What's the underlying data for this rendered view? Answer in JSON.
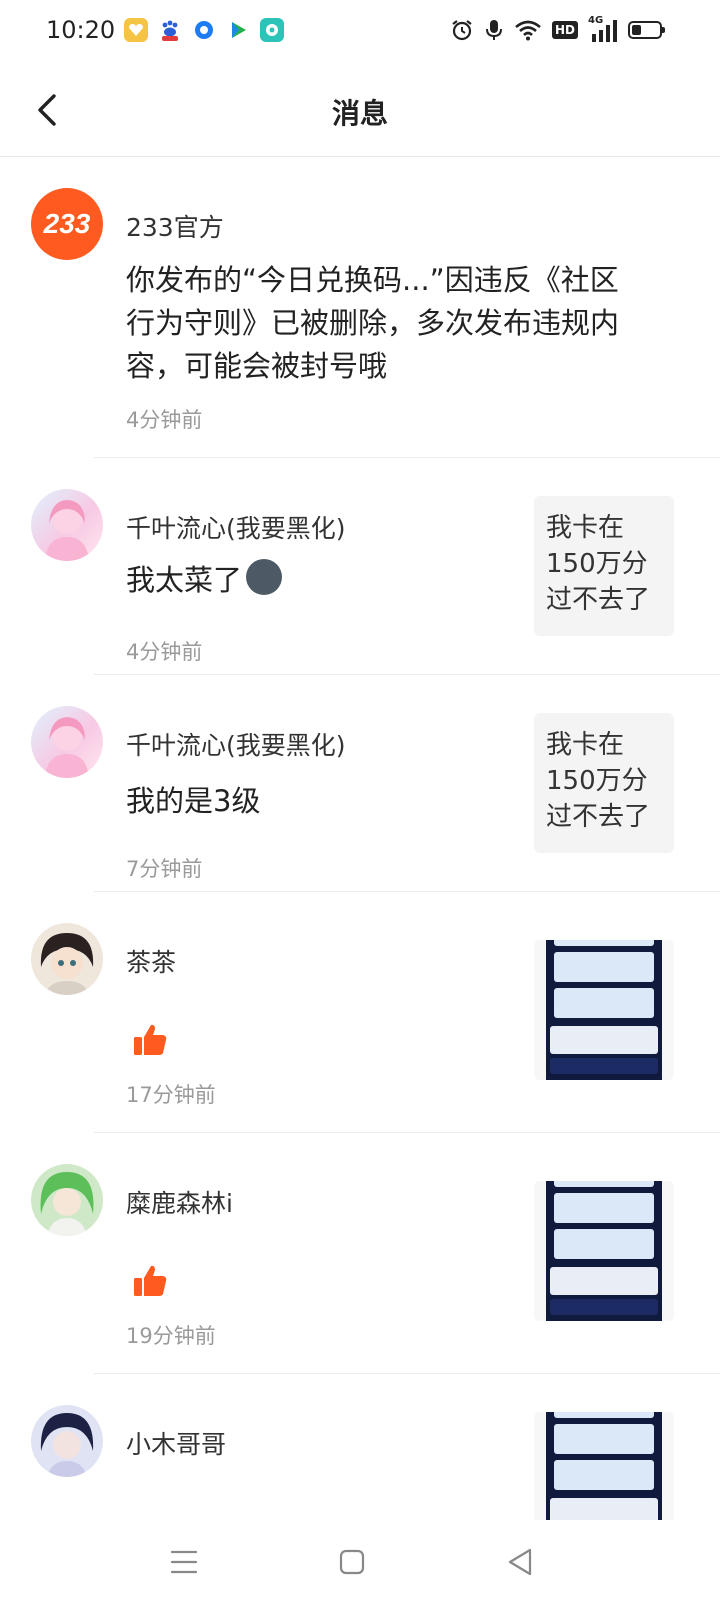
{
  "status_bar": {
    "time": "10:20",
    "network": "4G",
    "hd": "HD"
  },
  "header": {
    "title": "消息"
  },
  "messages": [
    {
      "user": "233官方",
      "avatar_text": "233",
      "avatar_color": "#ff5a1f",
      "text": "你发布的“今日兑换码...”因违反《社区行为守则》已被删除，多次发布违规内容，可能会被封号哦",
      "time": "4分钟前"
    },
    {
      "user": "千叶流心(我要黑化)",
      "text": "我太菜了",
      "emoji": "🌚",
      "time": "4分钟前",
      "quote": "我卡在150万分过不去了"
    },
    {
      "user": "千叶流心(我要黑化)",
      "text": "我的是3级",
      "time": "7分钟前",
      "quote": "我卡在150万分过不去了"
    },
    {
      "user": "茶茶",
      "time": "17分钟前",
      "action": "like-icon"
    },
    {
      "user": "糜鹿森林i",
      "time": "19分钟前",
      "action": "like-icon"
    },
    {
      "user": "小木哥哥"
    }
  ],
  "colors": {
    "accent": "#ff5a1f",
    "like": "#ff5a1f"
  }
}
